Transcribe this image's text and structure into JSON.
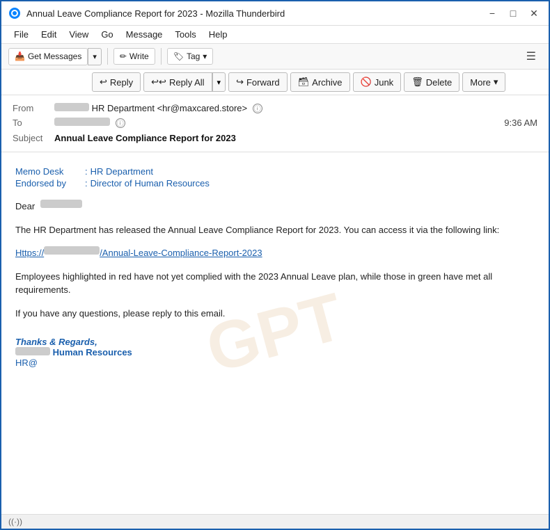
{
  "window": {
    "title": "Annual Leave Compliance Report for 2023 - Mozilla Thunderbird",
    "icon": "thunderbird-icon"
  },
  "titlebar": {
    "minimize_label": "−",
    "maximize_label": "□",
    "close_label": "✕"
  },
  "menubar": {
    "items": [
      {
        "id": "file",
        "label": "File"
      },
      {
        "id": "edit",
        "label": "Edit"
      },
      {
        "id": "view",
        "label": "View"
      },
      {
        "id": "go",
        "label": "Go"
      },
      {
        "id": "message",
        "label": "Message"
      },
      {
        "id": "tools",
        "label": "Tools"
      },
      {
        "id": "help",
        "label": "Help"
      }
    ]
  },
  "toolbar": {
    "get_messages_label": "Get Messages",
    "write_label": "Write",
    "tag_label": "Tag"
  },
  "actions": {
    "reply_label": "Reply",
    "reply_all_label": "Reply All",
    "forward_label": "Forward",
    "archive_label": "Archive",
    "junk_label": "Junk",
    "delete_label": "Delete",
    "more_label": "More"
  },
  "email": {
    "from_label": "From",
    "from_name": "HR Department",
    "from_email": "<hr@maxcared.store>",
    "to_label": "To",
    "time": "9:36 AM",
    "subject_label": "Subject",
    "subject": "Annual Leave Compliance Report for 2023"
  },
  "body": {
    "memo_desk_label": "Memo Desk",
    "memo_desk_value": "HR Department",
    "endorsed_by_label": "Endorsed by",
    "endorsed_by_value": "Director of Human Resources",
    "greeting": "Dear",
    "paragraph1": "The HR Department has released the Annual Leave Compliance Report for 2023. You can access it via the following link:",
    "link_text": "Https://                    /Annual-Leave-Compliance-Report-2023",
    "paragraph2": "Employees highlighted in red have not yet complied with the 2023 Annual Leave plan, while those in green have met all requirements.",
    "paragraph3": "If you have any questions, please reply to this email.",
    "sig_thanks": "Thanks & Regards,",
    "sig_name": "Human Resources",
    "sig_email": "HR@"
  },
  "statusbar": {
    "wifi_icon": "wifi-icon",
    "wifi_symbol": "((·))"
  }
}
